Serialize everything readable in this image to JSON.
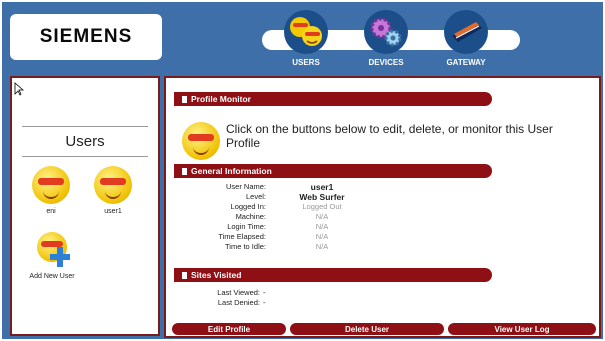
{
  "brand": {
    "logo_text": "SIEMENS"
  },
  "nav": {
    "items": [
      {
        "label": "USERS",
        "icon": "users-smiley-icon"
      },
      {
        "label": "DEVICES",
        "icon": "devices-gears-icon"
      },
      {
        "label": "GATEWAY",
        "icon": "gateway-device-icon"
      }
    ]
  },
  "sidebar": {
    "title": "Users",
    "users": [
      {
        "name": "eni"
      },
      {
        "name": "user1"
      }
    ],
    "add_new_label": "Add New User"
  },
  "main": {
    "profile_monitor": {
      "title": "Profile Monitor",
      "intro": "Click on the buttons below to edit, delete, or monitor this User Profile"
    },
    "general_info": {
      "title": "General Information",
      "rows": [
        {
          "label": "User Name:",
          "value": "user1",
          "bold": true
        },
        {
          "label": "Level:",
          "value": "Web Surfer",
          "bold": true
        },
        {
          "label": "Logged In:",
          "value": "Logged Out",
          "bold": false
        },
        {
          "label": "Machine:",
          "value": "N/A",
          "bold": false
        },
        {
          "label": "Login Time:",
          "value": "N/A",
          "bold": false
        },
        {
          "label": "Time Elapsed:",
          "value": "N/A",
          "bold": false
        },
        {
          "label": "Time to Idle:",
          "value": "N/A",
          "bold": false
        }
      ]
    },
    "sites_visited": {
      "title": "Sites Visited",
      "rows": [
        {
          "label": "Last Viewed:",
          "value": "-"
        },
        {
          "label": "Last Denied:",
          "value": "-"
        }
      ]
    },
    "buttons": {
      "edit": "Edit Profile",
      "delete": "Delete User",
      "view_log": "View User Log"
    }
  },
  "colors": {
    "header_blue": "#3e6fa8",
    "bar_red": "#8e0f14",
    "border": "#7a1b1b"
  }
}
